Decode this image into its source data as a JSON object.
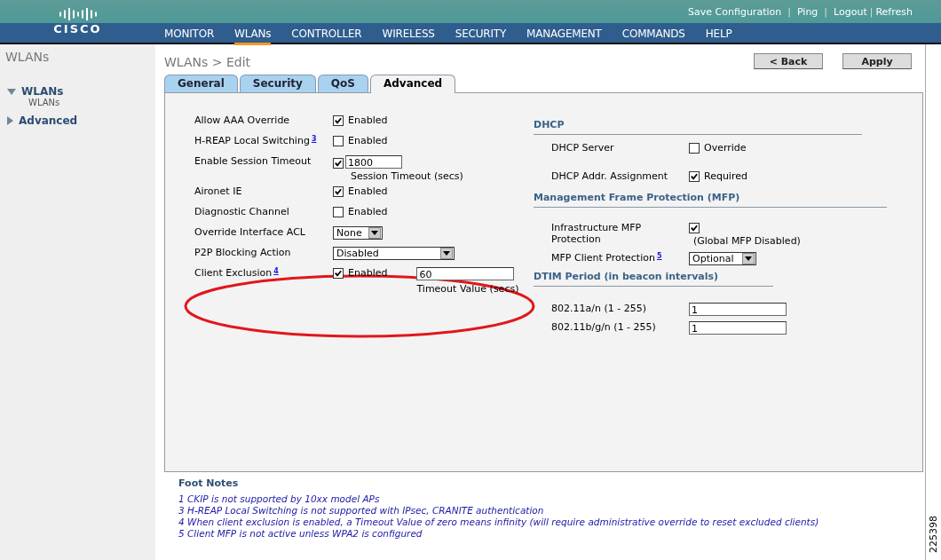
{
  "header": {
    "logo": "CISCO",
    "top_links": [
      "Save Configuration",
      "Ping",
      "Logout",
      "Refresh"
    ],
    "link_separator": "|",
    "nav": [
      {
        "label": "MONITOR",
        "selected": false
      },
      {
        "label": "WLANs",
        "selected": true
      },
      {
        "label": "CONTROLLER",
        "selected": false
      },
      {
        "label": "WIRELESS",
        "selected": false
      },
      {
        "label": "SECURITY",
        "selected": false
      },
      {
        "label": "MANAGEMENT",
        "selected": false
      },
      {
        "label": "COMMANDS",
        "selected": false
      },
      {
        "label": "HELP",
        "selected": false
      }
    ]
  },
  "sidebar": {
    "title": "WLANs",
    "items": [
      {
        "label": "WLANs",
        "expanded": true,
        "children": [
          {
            "label": "WLANs"
          }
        ]
      },
      {
        "label": "Advanced",
        "expanded": false
      }
    ]
  },
  "page": {
    "title": "WLANs > Edit",
    "buttons": [
      "< Back",
      "Apply"
    ],
    "tabs": [
      {
        "label": "General",
        "selected": false
      },
      {
        "label": "Security",
        "selected": false
      },
      {
        "label": "QoS",
        "selected": false
      },
      {
        "label": "Advanced",
        "selected": true
      }
    ]
  },
  "left_fields": [
    {
      "kind": "checkbox",
      "label": "Allow AAA Override",
      "checked": true,
      "option": "Enabled"
    },
    {
      "kind": "checkbox",
      "label": "H-REAP Local Switching",
      "footnote": "3",
      "checked": false,
      "option": "Enabled"
    },
    {
      "kind": "checkbox_input",
      "label": "Enable Session Timeout",
      "checked": true,
      "value": "1800",
      "caption": "Session Timeout (secs)"
    },
    {
      "kind": "checkbox",
      "label": "Aironet IE",
      "checked": true,
      "option": "Enabled"
    },
    {
      "kind": "checkbox",
      "label": "Diagnostic Channel",
      "checked": false,
      "option": "Enabled"
    },
    {
      "kind": "select",
      "label": "Override Interface ACL",
      "value": "None"
    },
    {
      "kind": "select_wide",
      "label": "P2P Blocking Action",
      "value": "Disabled"
    },
    {
      "kind": "checkbox_timeout",
      "label": "Client Exclusion",
      "footnote": "4",
      "checked": true,
      "option": "Enabled",
      "value": "60",
      "caption": "Timeout Value (secs)"
    }
  ],
  "right_sections": [
    {
      "heading": "DHCP",
      "fields": [
        {
          "kind": "checkbox",
          "label": "DHCP Server",
          "checked": false,
          "option": "Override"
        },
        {
          "kind": "checkbox",
          "label": "DHCP Addr. Assignment",
          "checked": true,
          "option": "Required"
        }
      ]
    },
    {
      "heading": "Management Frame Protection (MFP)",
      "fields": [
        {
          "kind": "checkbox_caption",
          "label": "Infrastructure MFP Protection",
          "checked": true,
          "caption": "(Global MFP Disabled)"
        },
        {
          "kind": "select",
          "label": "MFP Client Protection",
          "footnote": "5",
          "value": "Optional"
        }
      ]
    },
    {
      "heading": "DTIM Period (in beacon intervals)",
      "fields": [
        {
          "kind": "input",
          "label": "802.11a/n (1 - 255)",
          "value": "1"
        },
        {
          "kind": "input",
          "label": "802.11b/g/n (1 - 255)",
          "value": "1"
        }
      ]
    }
  ],
  "annotations": [
    {
      "kind": "ellipse"
    }
  ],
  "footnotes": {
    "title": "Foot Notes",
    "lines": [
      "1 CKIP is not supported by 10xx model APs",
      "3 H-REAP Local Switching is not supported with IPsec, CRANITE authentication",
      "4 When client exclusion is enabled, a Timeout Value of zero means infinity (will require administrative override to reset excluded clients)",
      "5 Client MFP is not active unless WPA2 is configured"
    ]
  },
  "figure_number": "225398"
}
